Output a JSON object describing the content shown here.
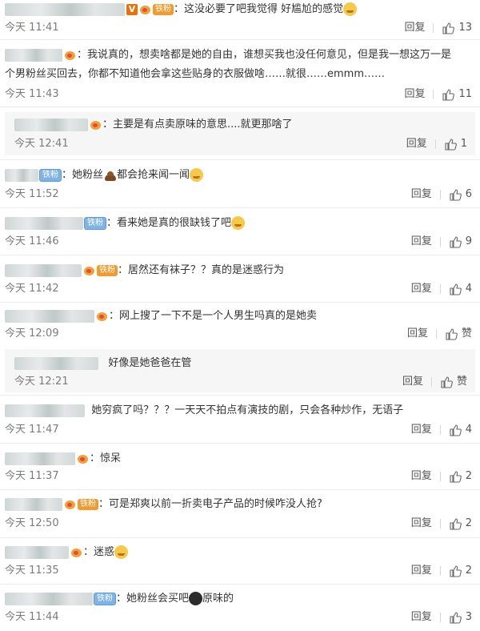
{
  "actions": {
    "reply": "回复"
  },
  "comments": [
    {
      "text": "：这没必要了吧我觉得 好尴尬的感觉",
      "time": "今天 11:41",
      "likes": "13",
      "fan": "铁粉",
      "vip": "V"
    },
    {
      "text": "：我说真的，想卖啥都是她的自由，谁想买我也没任何意见，但是我一想这万一是",
      "text2": "个男粉丝买回去，你都不知道他会拿这些贴身的衣服做啥……就很……emmm……",
      "time": "今天 11:43",
      "likes": "11"
    },
    {
      "text": "：主要是有点卖原味的意思....就更那啥了",
      "time": "今天 12:41",
      "likes": "1"
    },
    {
      "text": "：她粉丝",
      "text_after": "都会抢来闻一闻",
      "time": "今天 11:52",
      "likes": "6",
      "fan": "铁粉"
    },
    {
      "text": "：看来她是真的很缺钱了吧",
      "time": "今天 11:46",
      "likes": "9",
      "fan": "铁粉"
    },
    {
      "text": "：居然还有袜子？？真的是迷惑行为",
      "time": "今天 11:42",
      "likes": "4",
      "fan": "铁粉"
    },
    {
      "text": "：网上搜了一下不是一个人男生吗真的是她卖",
      "time": "今天 12:09",
      "likes": "赞"
    },
    {
      "text": "好像是她爸爸在管",
      "time": "今天 12:21",
      "likes": "赞"
    },
    {
      "text": "她穷疯了吗？？？一天天不拍点有演技的剧，只会各种炒作，无语子",
      "time": "今天 11:47",
      "likes": "4"
    },
    {
      "text": "：惊呆",
      "time": "今天 11:37",
      "likes": "2"
    },
    {
      "text": "：可是郑爽以前一折卖电子产品的时候咋没人抢?",
      "time": "今天 12:50",
      "likes": "2",
      "fan": "铁粉"
    },
    {
      "text": "：迷惑",
      "time": "今天 11:35",
      "likes": "2"
    },
    {
      "text": "：她粉丝会买吧",
      "text_after": "原味的",
      "time": "今天 11:44",
      "likes": "3",
      "fan": "铁粉"
    }
  ]
}
